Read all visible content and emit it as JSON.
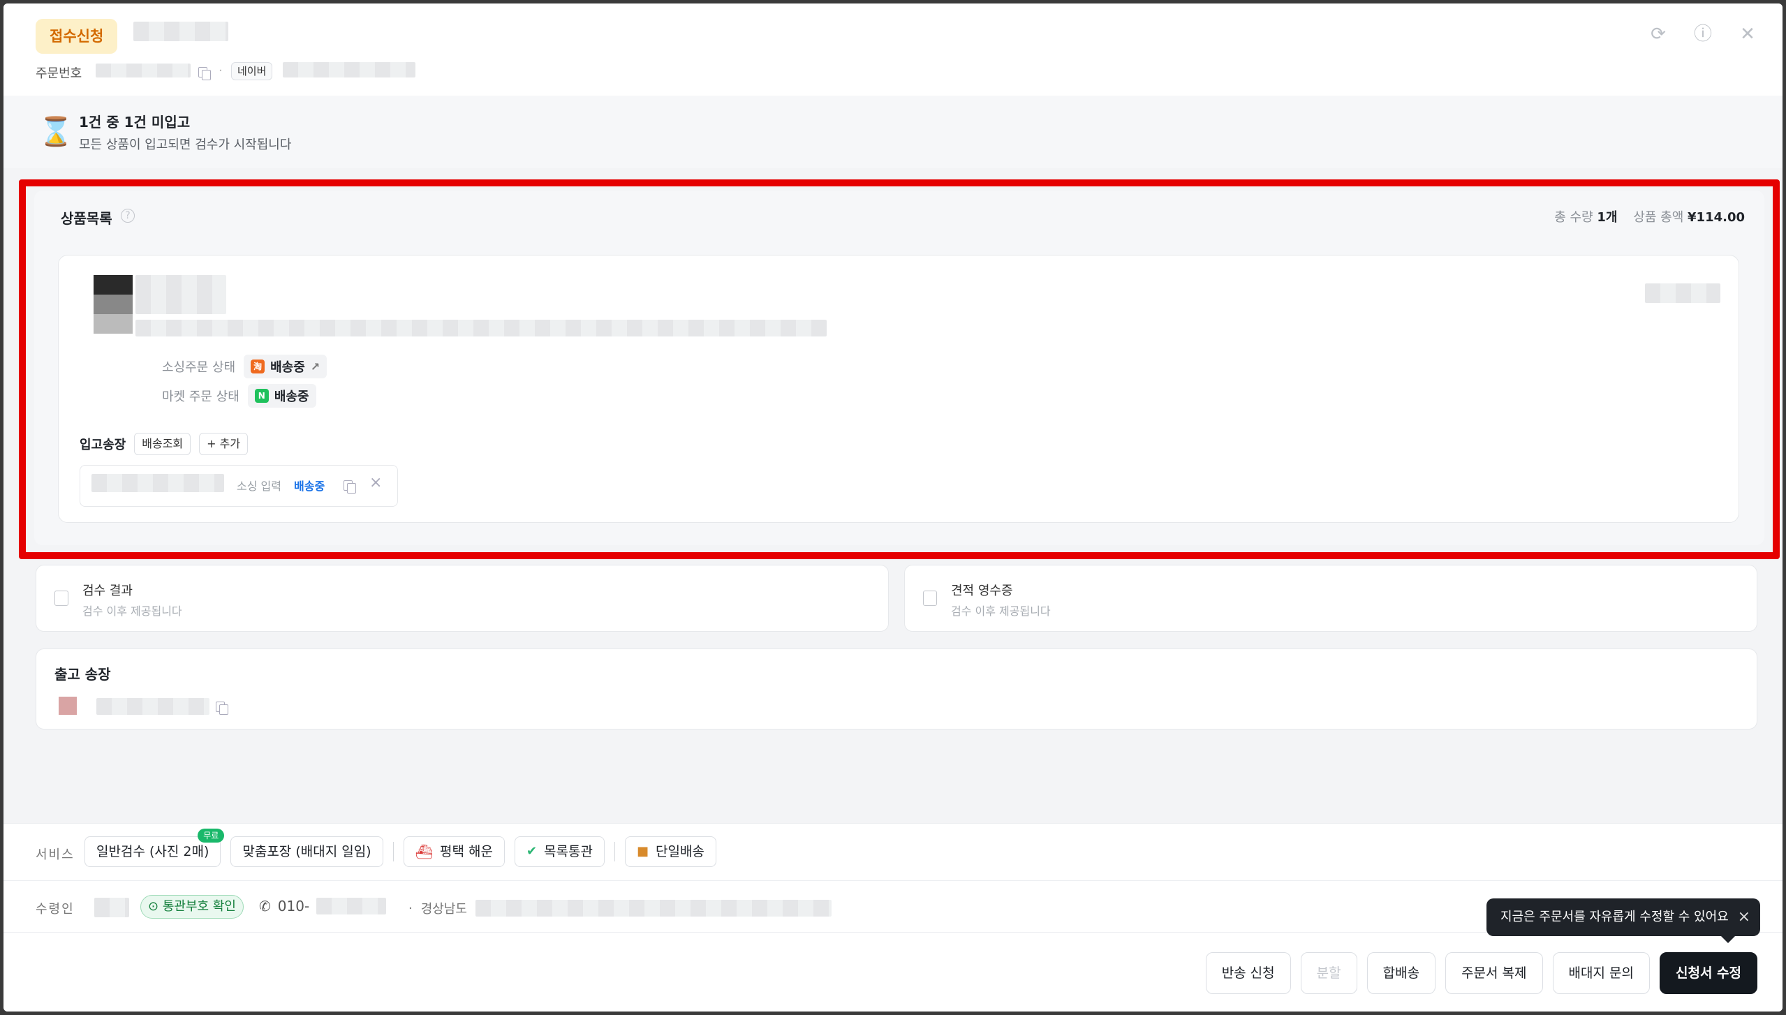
{
  "header": {
    "status": "접수신청",
    "order_label": "주문번호",
    "channel": "네이버",
    "icons": [
      "refresh-icon",
      "help-icon",
      "close-icon"
    ]
  },
  "notice": {
    "title": "1건 중 1건 미입고",
    "subtitle": "모든 상품이 입고되면 검수가 시작됩니다"
  },
  "products": {
    "title": "상품목록",
    "qty_label": "총 수량",
    "qty_value": "1개",
    "amount_label": "상품 총액",
    "amount_value": "¥114.00",
    "sourcing_status_label": "소싱주문 상태",
    "sourcing_status_value": "배송중",
    "market_status_label": "마켓 주문 상태",
    "market_status_value": "배송중",
    "inbound_label": "입고송장",
    "track_button": "배송조회",
    "add_button": "+ 추가",
    "tracking_source": "소싱 입력",
    "tracking_status": "배송중"
  },
  "inspection": {
    "title": "검수 결과",
    "subtitle": "검수 이후 제공됩니다"
  },
  "receipt": {
    "title": "견적 영수증",
    "subtitle": "검수 이후 제공됩니다"
  },
  "outbound": {
    "title": "출고 송장"
  },
  "services": {
    "label": "서비스",
    "items": [
      {
        "label": "일반검수 (사진 2매)",
        "badge": "무료"
      },
      {
        "label": "맞춤포장 (배대지 일임)"
      },
      {
        "label": "평택 해운",
        "icon": "ship-icon"
      },
      {
        "label": "목록통관",
        "icon": "check-doc-icon"
      },
      {
        "label": "단일배송",
        "icon": "box-icon"
      }
    ]
  },
  "receiver": {
    "label": "수령인",
    "customs_chip": "통관부호 확인",
    "phone_prefix": "010-",
    "address_prefix": "경상남도"
  },
  "tooltip": {
    "text": "지금은 주문서를 자유롭게 수정할 수 있어요"
  },
  "footer": {
    "buttons": [
      "반송 신청",
      "분할",
      "합배송",
      "주문서 복제",
      "배대지 문의",
      "신청서 수정"
    ]
  },
  "colors": {
    "highlight": "#e50000",
    "status_badge_bg": "#fdf0c8",
    "primary": "#14191f",
    "link": "#1a73e8"
  }
}
